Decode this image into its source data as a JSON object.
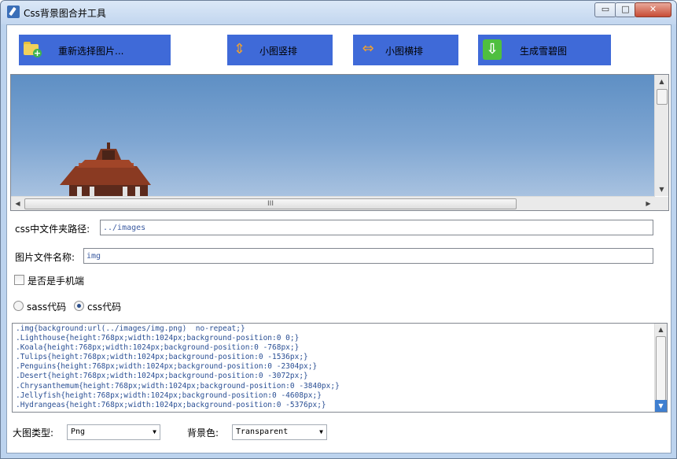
{
  "window": {
    "title": "Css背景图合并工具",
    "min_glyph": "▭",
    "max_glyph": "□",
    "close_glyph": "✕"
  },
  "toolbar": {
    "reselect_label": "重新选择图片...",
    "vertical_label": "小图竖排",
    "horizontal_label": "小图横排",
    "generate_label": "生成雪碧图"
  },
  "preview": {
    "hscroll_grip": "III"
  },
  "form": {
    "path_label": "css中文件夹路径:",
    "path_value": "../images",
    "name_label": "图片文件名称:",
    "name_value": "img",
    "mobile_label": "是否是手机端",
    "mobile_checked": false,
    "sass_label": "sass代码",
    "css_label": "css代码",
    "selected_format": "css"
  },
  "code": {
    "lines": [
      ".img{background:url(../images/img.png)  no-repeat;}",
      ".Lighthouse{height:768px;width:1024px;background-position:0 0;}",
      ".Koala{height:768px;width:1024px;background-position:0 -768px;}",
      ".Tulips{height:768px;width:1024px;background-position:0 -1536px;}",
      ".Penguins{height:768px;width:1024px;background-position:0 -2304px;}",
      ".Desert{height:768px;width:1024px;background-position:0 -3072px;}",
      ".Chrysanthemum{height:768px;width:1024px;background-position:0 -3840px;}",
      ".Jellyfish{height:768px;width:1024px;background-position:0 -4608px;}",
      ".Hydrangeas{height:768px;width:1024px;background-position:0 -5376px;}"
    ]
  },
  "footer": {
    "image_type_label": "大图类型:",
    "image_type_value": "Png",
    "bg_color_label": "背景色:",
    "bg_color_value": "Transparent"
  },
  "colors": {
    "button_bg": "#3f6ad8",
    "code_text": "#2a4f94"
  }
}
